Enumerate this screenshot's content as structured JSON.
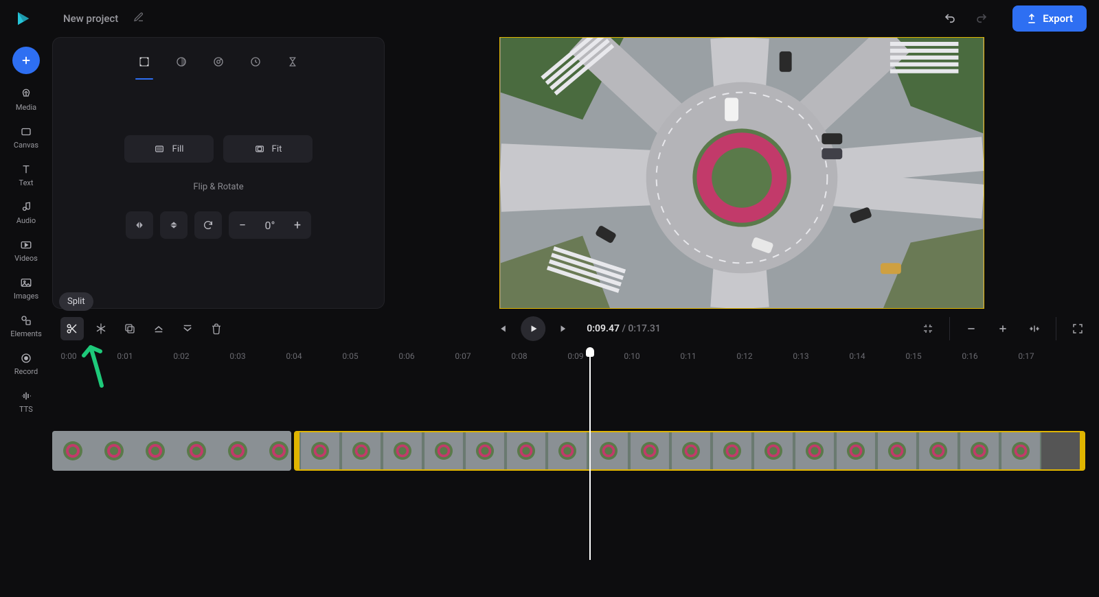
{
  "header": {
    "project_name": "New project",
    "export_label": "Export"
  },
  "leftrail": {
    "items": [
      {
        "label": "Media"
      },
      {
        "label": "Canvas"
      },
      {
        "label": "Text"
      },
      {
        "label": "Audio"
      },
      {
        "label": "Videos"
      },
      {
        "label": "Images"
      },
      {
        "label": "Elements"
      },
      {
        "label": "Record"
      },
      {
        "label": "TTS"
      }
    ]
  },
  "panel": {
    "fill_label": "Fill",
    "fit_label": "Fit",
    "flip_rotate_label": "Flip & Rotate",
    "rotation_value": "0°"
  },
  "playback": {
    "current": "0:09.47",
    "total": "0:17.31"
  },
  "timeline_toolbar": {
    "split_tooltip": "Split"
  },
  "ruler": {
    "ticks": [
      "0:00",
      "0:01",
      "0:02",
      "0:03",
      "0:04",
      "0:05",
      "0:06",
      "0:07",
      "0:08",
      "0:09",
      "0:10",
      "0:11",
      "0:12",
      "0:13",
      "0:14",
      "0:15",
      "0:16",
      "0:17"
    ]
  }
}
